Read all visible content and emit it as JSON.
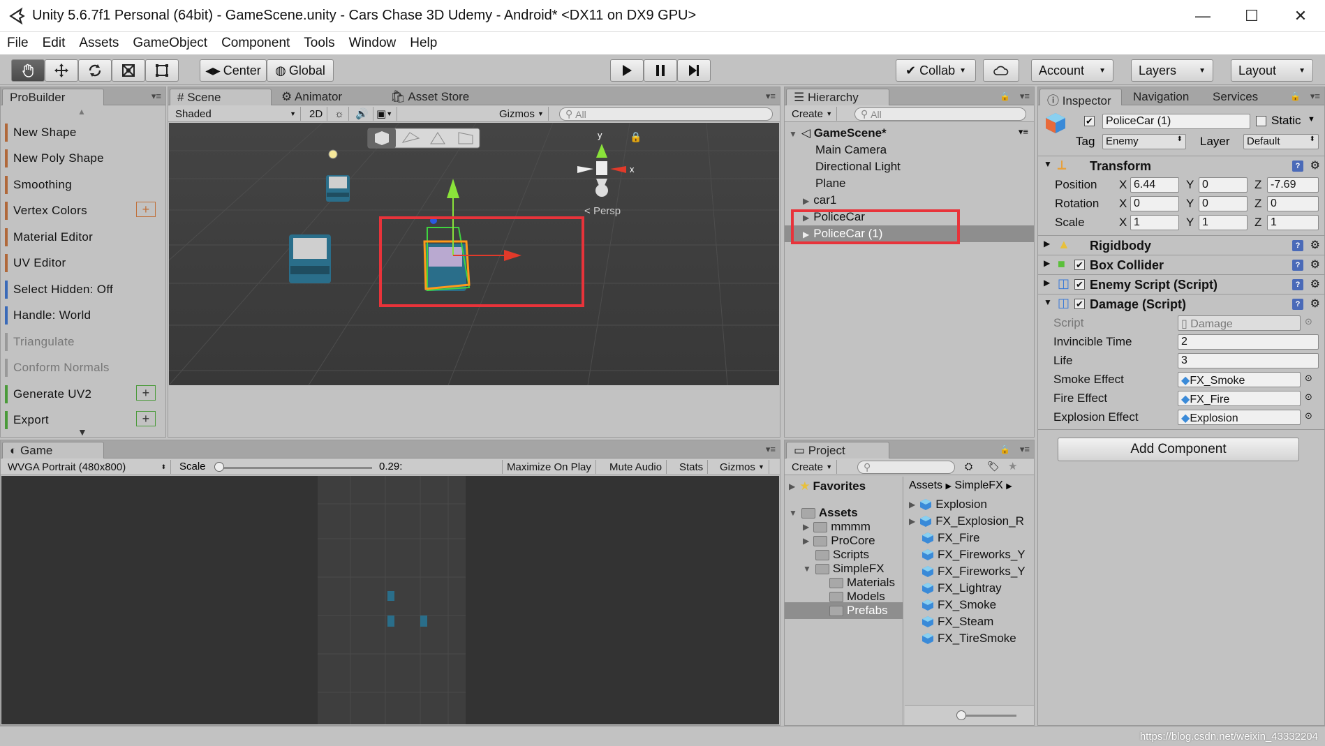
{
  "window": {
    "title": "Unity 5.6.7f1 Personal (64bit) - GameScene.unity - Cars Chase 3D Udemy - Android* <DX11 on DX9 GPU>",
    "minimize": "—",
    "maximize": "☐",
    "close": "✕"
  },
  "menu": [
    "File",
    "Edit",
    "Assets",
    "GameObject",
    "Component",
    "Tools",
    "Window",
    "Help"
  ],
  "toolbar": {
    "center": "Center",
    "global": "Global",
    "collab": "Collab",
    "account": "Account",
    "layers": "Layers",
    "layout": "Layout"
  },
  "probuilder": {
    "tab": "ProBuilder",
    "items": [
      "New Shape",
      "New Poly Shape",
      "Smoothing",
      "Vertex Colors",
      "Material Editor",
      "UV Editor",
      "Select Hidden: Off",
      "Handle: World",
      "Triangulate",
      "Conform Normals",
      "Generate UV2",
      "Export"
    ]
  },
  "scene": {
    "tabs": [
      "Scene",
      "Animator",
      "Asset Store"
    ],
    "shading": "Shaded",
    "mode2d": "2D",
    "gizmos": "Gizmos",
    "search_placeholder": "All",
    "persp": "Persp",
    "axis_y": "y",
    "axis_x": "x"
  },
  "game": {
    "tab": "Game",
    "resolution": "WVGA Portrait (480x800)",
    "scale_label": "Scale",
    "scale_value": "0.29:",
    "maximize": "Maximize On Play",
    "mute": "Mute Audio",
    "stats": "Stats",
    "gizmos": "Gizmos"
  },
  "hierarchy": {
    "tab": "Hierarchy",
    "create": "Create",
    "search_placeholder": "All",
    "scene": "GameScene*",
    "items": [
      "Main Camera",
      "Directional Light",
      "Plane",
      "car1",
      "PoliceCar",
      "PoliceCar (1)"
    ]
  },
  "inspector": {
    "tabs": [
      "Inspector",
      "Navigation",
      "Services"
    ],
    "object_name": "PoliceCar (1)",
    "static": "Static",
    "tag_label": "Tag",
    "tag": "Enemy",
    "layer_label": "Layer",
    "layer": "Default",
    "transform": {
      "title": "Transform",
      "position_label": "Position",
      "rotation_label": "Rotation",
      "scale_label": "Scale",
      "position": {
        "x": "6.44",
        "y": "0",
        "z": "-7.69"
      },
      "rotation": {
        "x": "0",
        "y": "0",
        "z": "0"
      },
      "scale": {
        "x": "1",
        "y": "1",
        "z": "1"
      },
      "X": "X",
      "Y": "Y",
      "Z": "Z"
    },
    "components": [
      "Rigidbody",
      "Box Collider",
      "Enemy Script (Script)",
      "Damage (Script)"
    ],
    "damage": {
      "script_label": "Script",
      "script": "Damage",
      "invincible_label": "Invincible Time",
      "invincible": "2",
      "life_label": "Life",
      "life": "3",
      "smoke_label": "Smoke Effect",
      "smoke": "FX_Smoke",
      "fire_label": "Fire Effect",
      "fire": "FX_Fire",
      "explosion_label": "Explosion Effect",
      "explosion": "Explosion"
    },
    "add_component": "Add Component"
  },
  "project": {
    "tab": "Project",
    "create": "Create",
    "favorites": "Favorites",
    "assets": "Assets",
    "tree": [
      "mmmm",
      "ProCore",
      "Scripts",
      "SimpleFX",
      "Materials",
      "Models",
      "Prefabs"
    ],
    "breadcrumb": [
      "Assets",
      "SimpleFX"
    ],
    "files": [
      "Explosion",
      "FX_Explosion_R",
      "FX_Fire",
      "FX_Fireworks_Y",
      "FX_Fireworks_Y",
      "FX_Lightray",
      "FX_Smoke",
      "FX_Steam",
      "FX_TireSmoke"
    ]
  },
  "watermark": "https://blog.csdn.net/weixin_43332204",
  "colors": {
    "highlight": "#e8333a",
    "selection": "#8e8e8e"
  }
}
